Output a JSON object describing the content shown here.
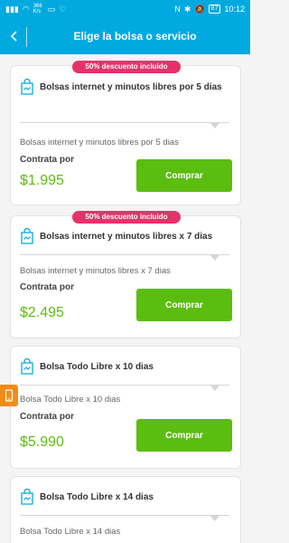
{
  "status_bar": {
    "network_speed": "366 K/s",
    "battery": "87",
    "time": "10:12"
  },
  "header": {
    "title": "Elige la bolsa o servicio"
  },
  "cards": [
    {
      "badge": "50% descuento incluido",
      "title": "Bolsas internet y minutos libres por 5 dias",
      "description": "Bolsas internet y minutos libres por 5 dias",
      "contrata_label": "Contrata por",
      "price": "$1.995",
      "button_label": "Comprar"
    },
    {
      "badge": "50% descuento incluido",
      "title": "Bolsas internet y minutos libres x 7 dias",
      "description": "Bolsas internet y minutos libres x 7 dias",
      "contrata_label": "Contrata por",
      "price": "$2.495",
      "button_label": "Comprar"
    },
    {
      "title": "Bolsa Todo Libre x 10 dias",
      "description": "Bolsa Todo Libre x 10 dias",
      "contrata_label": "Contrata por",
      "price": "$5.990",
      "button_label": "Comprar"
    },
    {
      "title": "Bolsa Todo Libre x 14 dias",
      "description": "Bolsa Todo Libre x 14 dias"
    }
  ],
  "colors": {
    "header": "#00a9e0",
    "badge": "#e5336a",
    "price": "#5bbd0f",
    "button": "#5bbd0f",
    "side_tab": "#f28c16"
  }
}
